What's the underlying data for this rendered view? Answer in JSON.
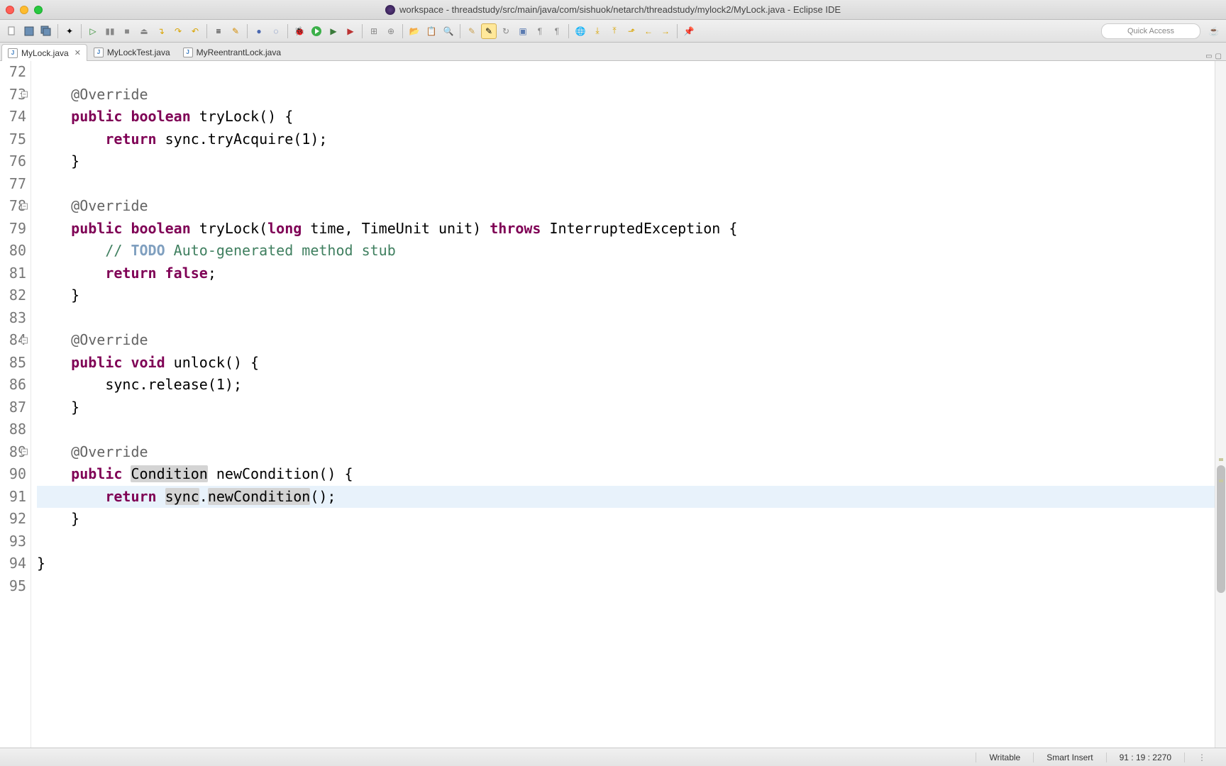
{
  "window": {
    "title": "workspace - threadstudy/src/main/java/com/sishuok/netarch/threadstudy/mylock2/MyLock.java - Eclipse IDE"
  },
  "quick_access": {
    "placeholder": "Quick Access"
  },
  "tabs": [
    {
      "label": "MyLock.java",
      "active": true
    },
    {
      "label": "MyLockTest.java",
      "active": false
    },
    {
      "label": "MyReentrantLock.java",
      "active": false
    }
  ],
  "code": {
    "lines": [
      {
        "num": "72",
        "fold": false
      },
      {
        "num": "73",
        "fold": true
      },
      {
        "num": "74",
        "fold": false
      },
      {
        "num": "75",
        "fold": false
      },
      {
        "num": "76",
        "fold": false
      },
      {
        "num": "77",
        "fold": false
      },
      {
        "num": "78",
        "fold": true
      },
      {
        "num": "79",
        "fold": false
      },
      {
        "num": "80",
        "fold": false
      },
      {
        "num": "81",
        "fold": false
      },
      {
        "num": "82",
        "fold": false
      },
      {
        "num": "83",
        "fold": false
      },
      {
        "num": "84",
        "fold": true
      },
      {
        "num": "85",
        "fold": false
      },
      {
        "num": "86",
        "fold": false
      },
      {
        "num": "87",
        "fold": false
      },
      {
        "num": "88",
        "fold": false
      },
      {
        "num": "89",
        "fold": true
      },
      {
        "num": "90",
        "fold": false
      },
      {
        "num": "91",
        "fold": false
      },
      {
        "num": "92",
        "fold": false
      },
      {
        "num": "93",
        "fold": false
      },
      {
        "num": "94",
        "fold": false
      },
      {
        "num": "95",
        "fold": false
      }
    ],
    "tokens": {
      "override": "@Override",
      "public": "public",
      "boolean": "boolean",
      "void": "void",
      "return": "return",
      "false": "false",
      "long": "long",
      "throws": "throws",
      "todo": "TODO",
      "tryLock0": " tryLock() {",
      "retTryAcquire": " sync.tryAcquire(1);",
      "closeBrace": "    }",
      "tryLock1": " tryLock(",
      "timeParam": " time, TimeUnit unit) ",
      "interrupted": " InterruptedException {",
      "cmtPrefix": "        // ",
      "autogen": " Auto-generated method stub",
      "retFalse_a": "        ",
      "retFalse_b": ";",
      "unlock": " unlock() {",
      "release": "        sync.release(1);",
      "condition": "Condition",
      "newCond": " newCondition() {",
      "retNewCond_a": "        ",
      "retNewCond_b": " ",
      "sync": "sync",
      "dot": ".",
      "newCondCall": "newCondition",
      "parenSemi": "();",
      "classClose": "}"
    }
  },
  "status": {
    "writable": "Writable",
    "insert": "Smart Insert",
    "position": "91 : 19 : 2270"
  }
}
